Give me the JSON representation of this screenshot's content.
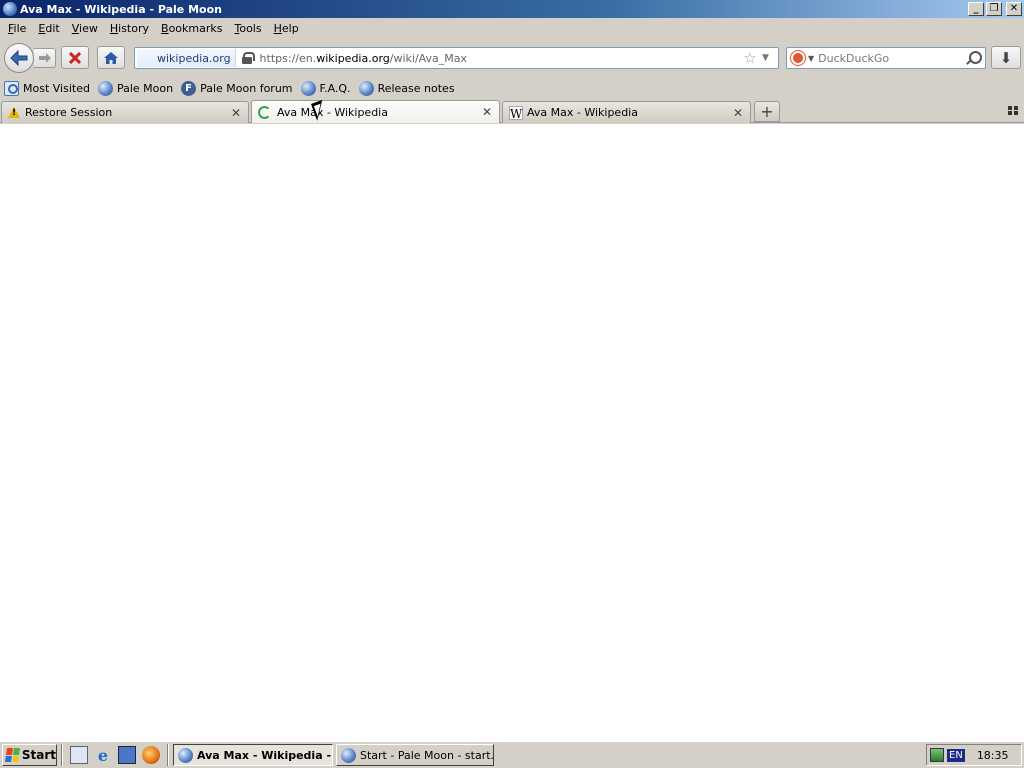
{
  "window": {
    "title": "Ava Max - Wikipedia - Pale Moon"
  },
  "menu": [
    "File",
    "Edit",
    "View",
    "History",
    "Bookmarks",
    "Tools",
    "Help"
  ],
  "navbar": {
    "identity_label": "wikipedia.org",
    "url_prefix": "https://en.",
    "url_domain": "wikipedia.org",
    "url_path": "/wiki/Ava_Max",
    "search_engine": "DuckDuckGo",
    "search_placeholder": "DuckDuckGo"
  },
  "bookmarks": [
    "Most Visited",
    "Pale Moon",
    "Pale Moon forum",
    "F.A.Q.",
    "Release notes"
  ],
  "tabs": [
    {
      "label": "Restore Session",
      "icon": "warning-icon",
      "selected": false
    },
    {
      "label": "Ava Max - Wikipedia",
      "icon": "loading-throbber-icon",
      "selected": true
    },
    {
      "label": "Ava Max - Wikipedia",
      "icon": "wikipedia-icon",
      "selected": false
    }
  ],
  "taskbar": {
    "start_label": "Start",
    "tasks": [
      {
        "label": "Ava Max - Wikipedia - ...",
        "active": true
      },
      {
        "label": "Start - Pale Moon - start....",
        "active": false
      }
    ],
    "language": "EN",
    "clock": "18:35"
  },
  "colors": {
    "titlebar_start": "#0a246a",
    "titlebar_end": "#a6caf0",
    "chrome_bg": "#d4d0c8",
    "content_bg": "#ffffff"
  }
}
